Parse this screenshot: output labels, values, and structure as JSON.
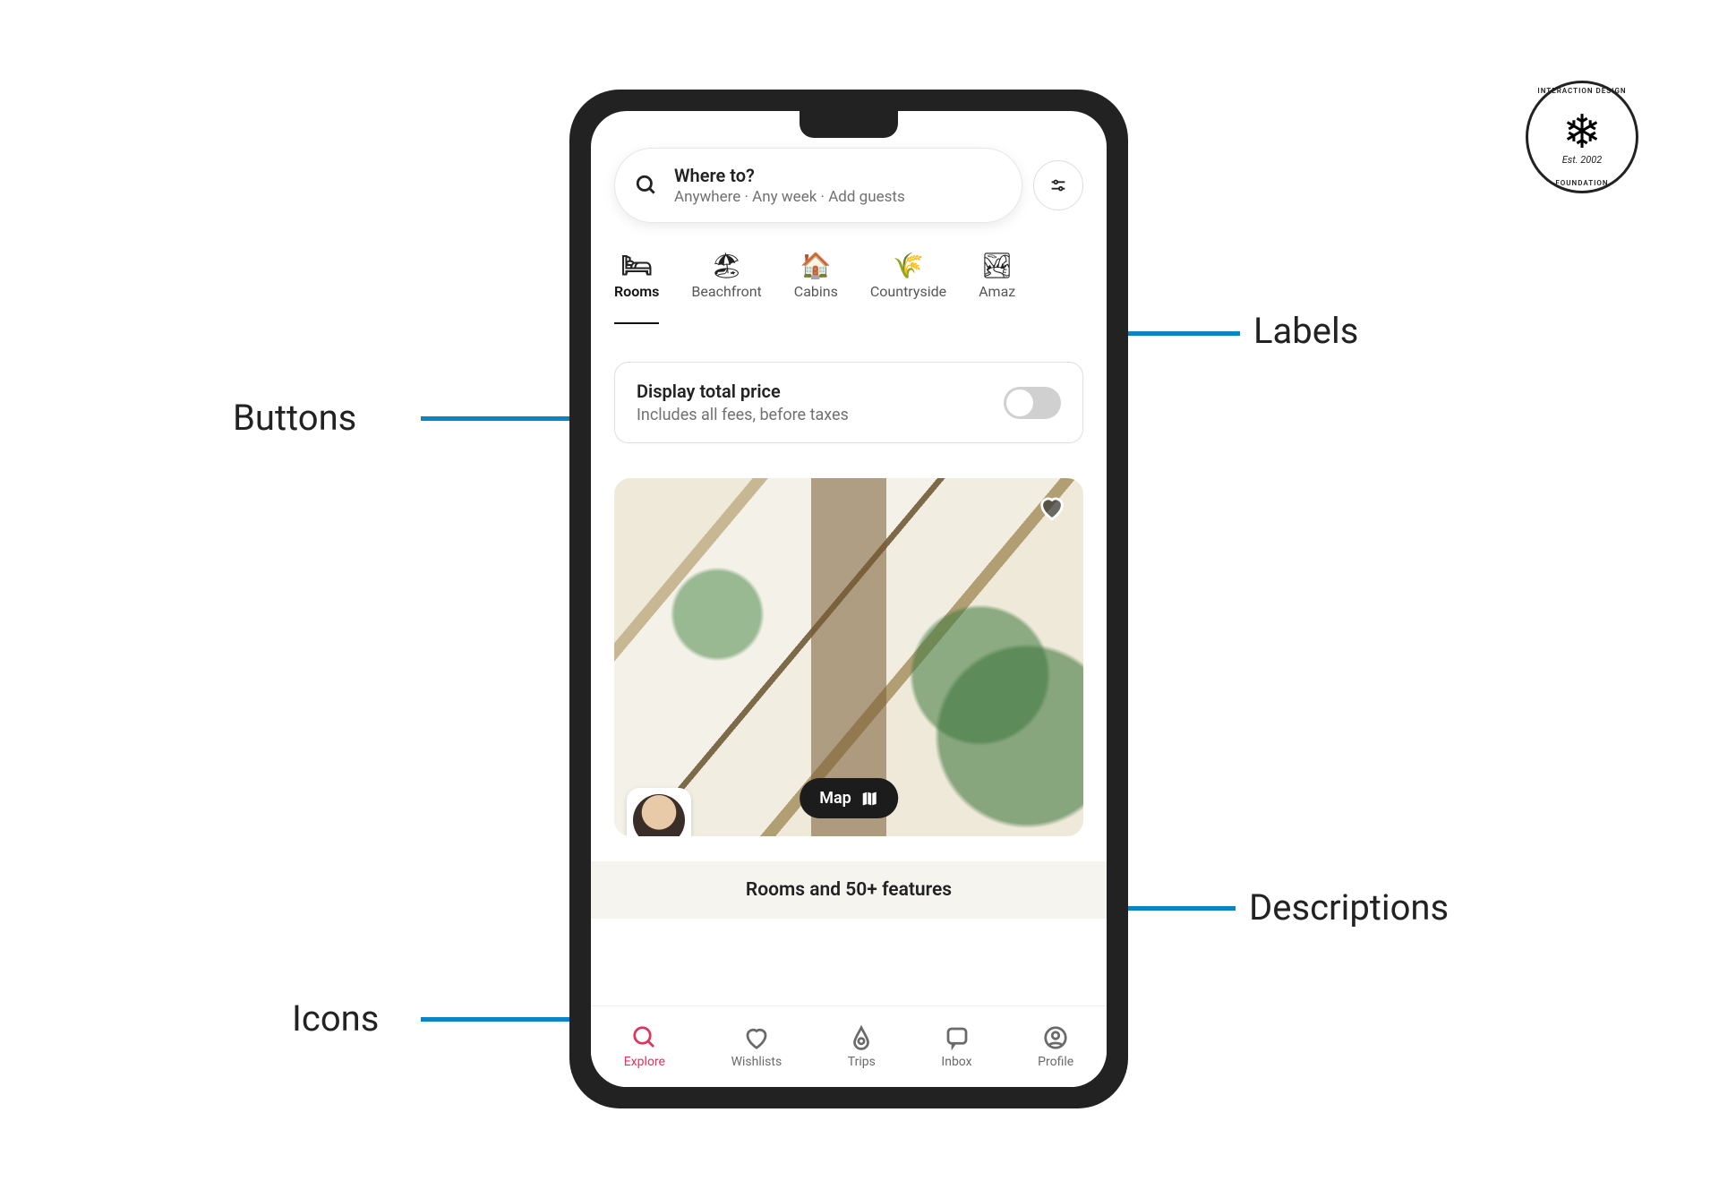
{
  "annotations": {
    "labels": "Labels",
    "buttons": "Buttons",
    "descriptions": "Descriptions",
    "icons": "Icons"
  },
  "logo": {
    "name_line1": "INTERACTION DESIGN",
    "name_line2": "FOUNDATION",
    "est": "Est. 2002"
  },
  "search": {
    "title": "Where to?",
    "subtitle": "Anywhere · Any week · Add guests"
  },
  "categories": [
    {
      "label": "Rooms",
      "glyph": "🛏",
      "active": true
    },
    {
      "label": "Beachfront",
      "glyph": "🏖",
      "active": false
    },
    {
      "label": "Cabins",
      "glyph": "🏠",
      "active": false
    },
    {
      "label": "Countryside",
      "glyph": "🌾",
      "active": false
    },
    {
      "label": "Amaz",
      "glyph": "🏞",
      "active": false
    }
  ],
  "price_card": {
    "title": "Display total price",
    "subtitle": "Includes all fees, before taxes"
  },
  "map_button": "Map",
  "banner": "Rooms and 50+ features",
  "bottom_nav": [
    {
      "label": "Explore",
      "active": true
    },
    {
      "label": "Wishlists",
      "active": false
    },
    {
      "label": "Trips",
      "active": false
    },
    {
      "label": "Inbox",
      "active": false
    },
    {
      "label": "Profile",
      "active": false
    }
  ]
}
